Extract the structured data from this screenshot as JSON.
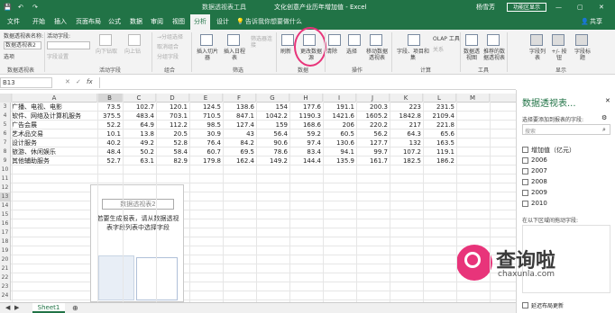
{
  "titlebar": {
    "context_tool": "数据透视表工具",
    "doc_title": "文化创意产业历年增加值 - Excel",
    "user": "杨雪芳",
    "share_button": "共享",
    "minimize": "—",
    "restore": "▢",
    "close": "✕"
  },
  "tabs": [
    "文件",
    "开始",
    "插入",
    "页面布局",
    "公式",
    "数据",
    "审阅",
    "视图",
    "分析",
    "设计"
  ],
  "active_tab": "分析",
  "tell_me": "告诉我你想要做什么",
  "ribbon": {
    "pivot_name_label": "数据透视表名称:",
    "pivot_name_value": "数据透视表2",
    "options_label": "选项",
    "active_field_label": "活动字段:",
    "field_settings": "字段设置",
    "drill_down": "向下钻取",
    "drill_up": "向上钻",
    "group_selection": "→分组选择",
    "ungroup": "取消组合",
    "group_field": "分组字段",
    "insert_slicer": "插入切片器",
    "insert_timeline": "插入日程表",
    "filter_connections": "筛选器连接",
    "refresh": "刷新",
    "change_source": "更改数据源",
    "clear": "清除",
    "select": "选择",
    "move": "移动数据透视表",
    "fields_items": "字段、项目和集",
    "olap": "OLAP 工具",
    "relationships": "关系",
    "pivot_chart": "数据透视图",
    "recommended": "推荐的数据透视表",
    "field_list": "字段列表",
    "buttons": "+/- 按钮",
    "headers": "字段标题",
    "groups": {
      "pivot": "数据透视表",
      "active": "活动字段",
      "group": "组合",
      "filter": "筛选",
      "data": "数据",
      "actions": "操作",
      "calc": "计算",
      "tools": "工具",
      "show": "显示"
    }
  },
  "formula_bar": {
    "name_box": "B13",
    "cancel": "✕",
    "enter": "✓",
    "fx": "fx",
    "value": ""
  },
  "columns": [
    "A",
    "B",
    "C",
    "D",
    "E",
    "F",
    "G",
    "H",
    "I",
    "J",
    "K",
    "L",
    "M"
  ],
  "rows": [
    {
      "n": "3",
      "a": "广播、电视、电影",
      "v": [
        "73.5",
        "102.7",
        "120.1",
        "124.5",
        "138.6",
        "154",
        "177.6",
        "191.1",
        "200.3",
        "223",
        "231.5"
      ]
    },
    {
      "n": "4",
      "a": "软件、网络及计算机服务",
      "v": [
        "375.5",
        "483.4",
        "703.1",
        "710.5",
        "847.1",
        "1042.2",
        "1190.3",
        "1421.6",
        "1605.2",
        "1842.8",
        "2109.4"
      ]
    },
    {
      "n": "5",
      "a": "广告会展",
      "v": [
        "52.2",
        "64.9",
        "112.2",
        "98.5",
        "127.4",
        "159",
        "168.6",
        "206",
        "220.2",
        "217",
        "221.8"
      ]
    },
    {
      "n": "6",
      "a": "艺术品交易",
      "v": [
        "10.1",
        "13.8",
        "20.5",
        "30.9",
        "43",
        "56.4",
        "59.2",
        "60.5",
        "56.2",
        "64.3",
        "65.6"
      ]
    },
    {
      "n": "7",
      "a": "设计服务",
      "v": [
        "40.2",
        "49.2",
        "52.8",
        "76.4",
        "84.2",
        "90.6",
        "97.4",
        "130.6",
        "127.7",
        "132",
        "163.5"
      ]
    },
    {
      "n": "8",
      "a": "旅游、休闲娱乐",
      "v": [
        "48.4",
        "50.2",
        "58.4",
        "60.7",
        "69.5",
        "78.6",
        "83.4",
        "94.1",
        "99.7",
        "107.2",
        "119.1"
      ]
    },
    {
      "n": "9",
      "a": "其他辅助服务",
      "v": [
        "52.7",
        "63.1",
        "82.9",
        "179.8",
        "162.4",
        "149.2",
        "144.4",
        "135.9",
        "161.7",
        "182.5",
        "186.2"
      ]
    },
    {
      "n": "10",
      "a": "",
      "v": []
    },
    {
      "n": "11",
      "a": "",
      "v": []
    },
    {
      "n": "12",
      "a": "",
      "v": []
    },
    {
      "n": "13",
      "a": "",
      "v": []
    },
    {
      "n": "14",
      "a": "",
      "v": []
    },
    {
      "n": "15",
      "a": "",
      "v": []
    },
    {
      "n": "16",
      "a": "",
      "v": []
    },
    {
      "n": "17",
      "a": "",
      "v": []
    },
    {
      "n": "18",
      "a": "",
      "v": []
    },
    {
      "n": "19",
      "a": "",
      "v": []
    },
    {
      "n": "20",
      "a": "",
      "v": []
    },
    {
      "n": "21",
      "a": "",
      "v": []
    },
    {
      "n": "22",
      "a": "",
      "v": []
    },
    {
      "n": "23",
      "a": "",
      "v": []
    },
    {
      "n": "24",
      "a": "",
      "v": []
    }
  ],
  "pivot_placeholder": {
    "title": "数据透视表2",
    "message": "若要生成报表，请从数据透视表字段列表中选择字段"
  },
  "pane": {
    "title": "数据透视表...",
    "close": "✕",
    "prompt": "选择要添加到报表的字段:",
    "search": "搜索",
    "fields": [
      "增加值（亿元）",
      "2006",
      "2007",
      "2008",
      "2009",
      "2010"
    ],
    "drag_label": "在以下区域间拖动字段:",
    "defer": "延迟布局更新"
  },
  "sheet_tab": "Sheet1",
  "watermark": {
    "cn": "查询啦",
    "url": "chaxunla.com"
  },
  "colors": {
    "excel_green": "#217346",
    "annotation_circle": "#e8347a"
  }
}
